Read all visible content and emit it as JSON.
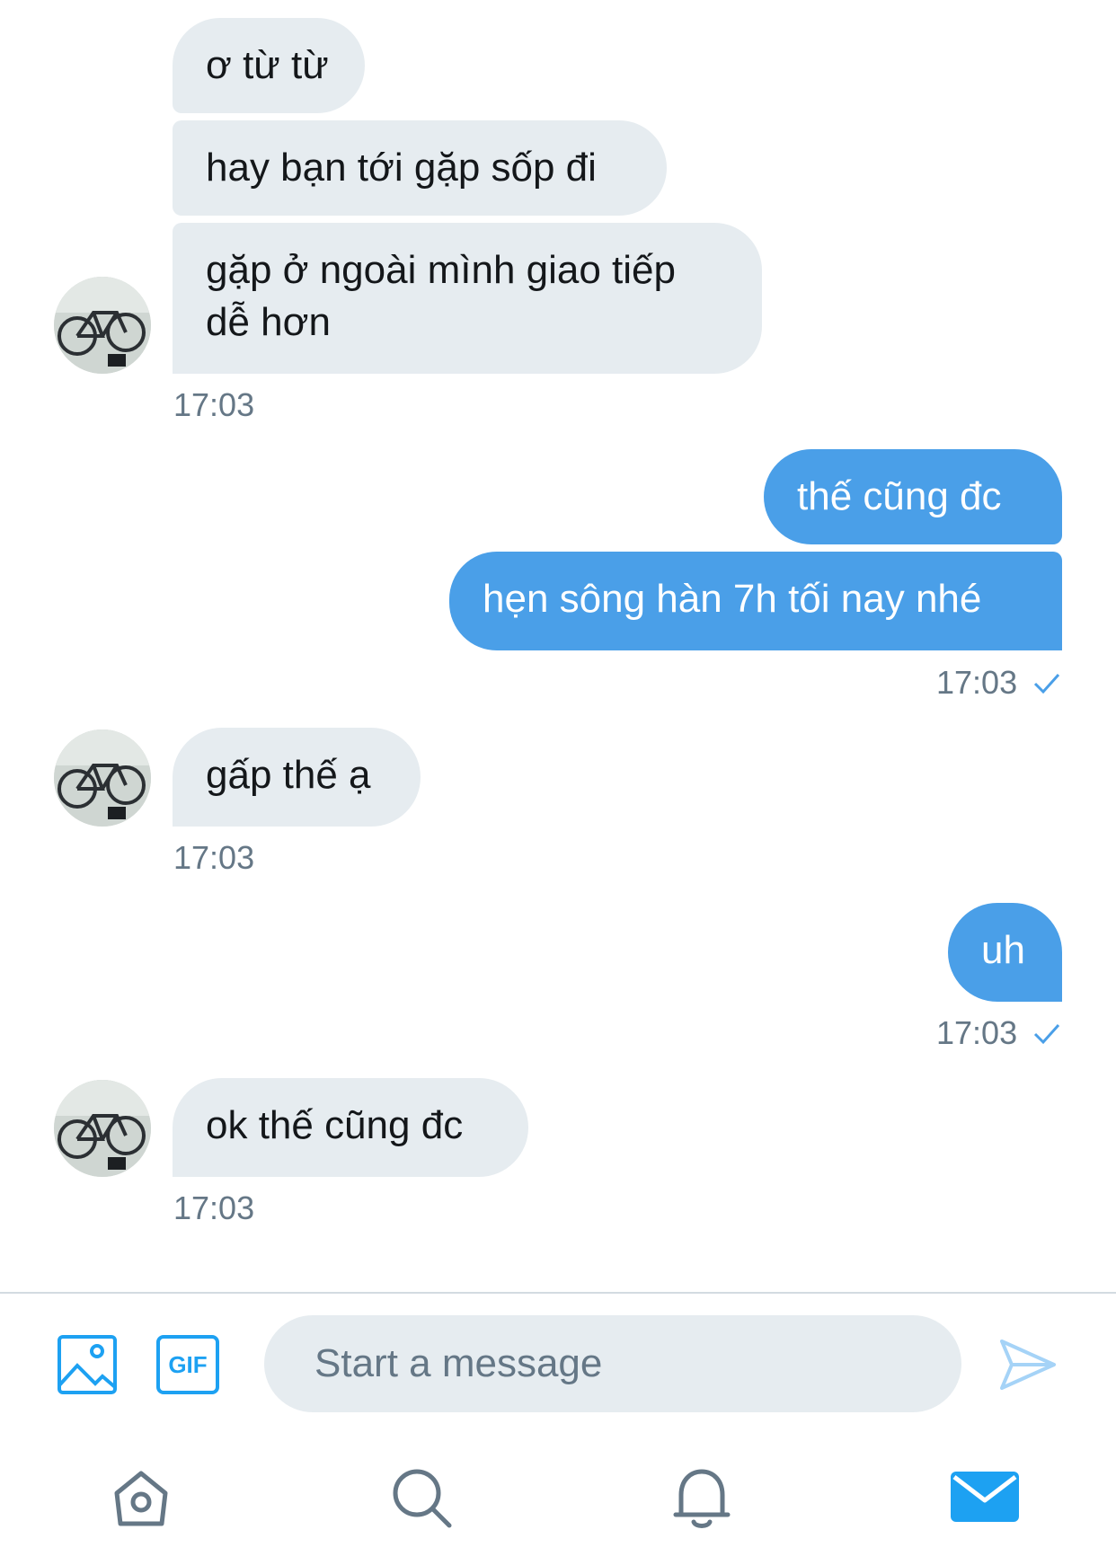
{
  "messages": [
    {
      "side": "in",
      "text": "ơ từ từ"
    },
    {
      "side": "in",
      "text": "hay bạn tới gặp sốp đi"
    },
    {
      "side": "in",
      "line1": "gặp ở ngoài mình giao tiếp",
      "line2": "dễ hơn"
    },
    {
      "side": "out",
      "text": "thế cũng đc"
    },
    {
      "side": "out",
      "text": "hẹn sông hàn 7h tối nay nhé"
    },
    {
      "side": "in",
      "text": "gấp thế ạ"
    },
    {
      "side": "out",
      "text": "uh"
    },
    {
      "side": "in",
      "text": "ok thế cũng đc"
    }
  ],
  "timestamps": [
    "17:03",
    "17:03",
    "17:03",
    "17:03",
    "17:03"
  ],
  "composer": {
    "placeholder": "Start a message",
    "gif_label": "GIF",
    "icons": [
      "image-icon",
      "gif-icon",
      "send-icon"
    ]
  },
  "tabbar": {
    "icons": [
      "home-icon",
      "search-icon",
      "notifications-icon",
      "messages-icon"
    ],
    "active": "messages-icon"
  },
  "colors": {
    "accent": "#1da1f2",
    "outgoing_bubble": "#4a9fe8",
    "incoming_bubble": "#e6ecf0",
    "timestamp": "#657786"
  }
}
